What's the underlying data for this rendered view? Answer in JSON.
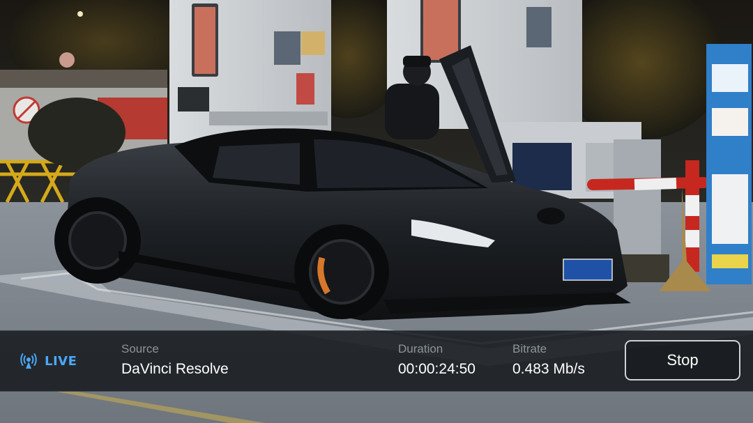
{
  "status_bar": {
    "live_label": "LIVE",
    "source": {
      "label": "Source",
      "value": "DaVinci Resolve"
    },
    "duration": {
      "label": "Duration",
      "value": "00:00:24:50"
    },
    "bitrate": {
      "label": "Bitrate",
      "value": "0.483 Mb/s"
    },
    "stop_label": "Stop"
  },
  "colors": {
    "live_accent": "#4aa8ff",
    "bar_background": "#181b1f",
    "label_gray": "#8e949b",
    "value_white": "#ffffff"
  },
  "icons": {
    "live": "broadcast-icon"
  }
}
